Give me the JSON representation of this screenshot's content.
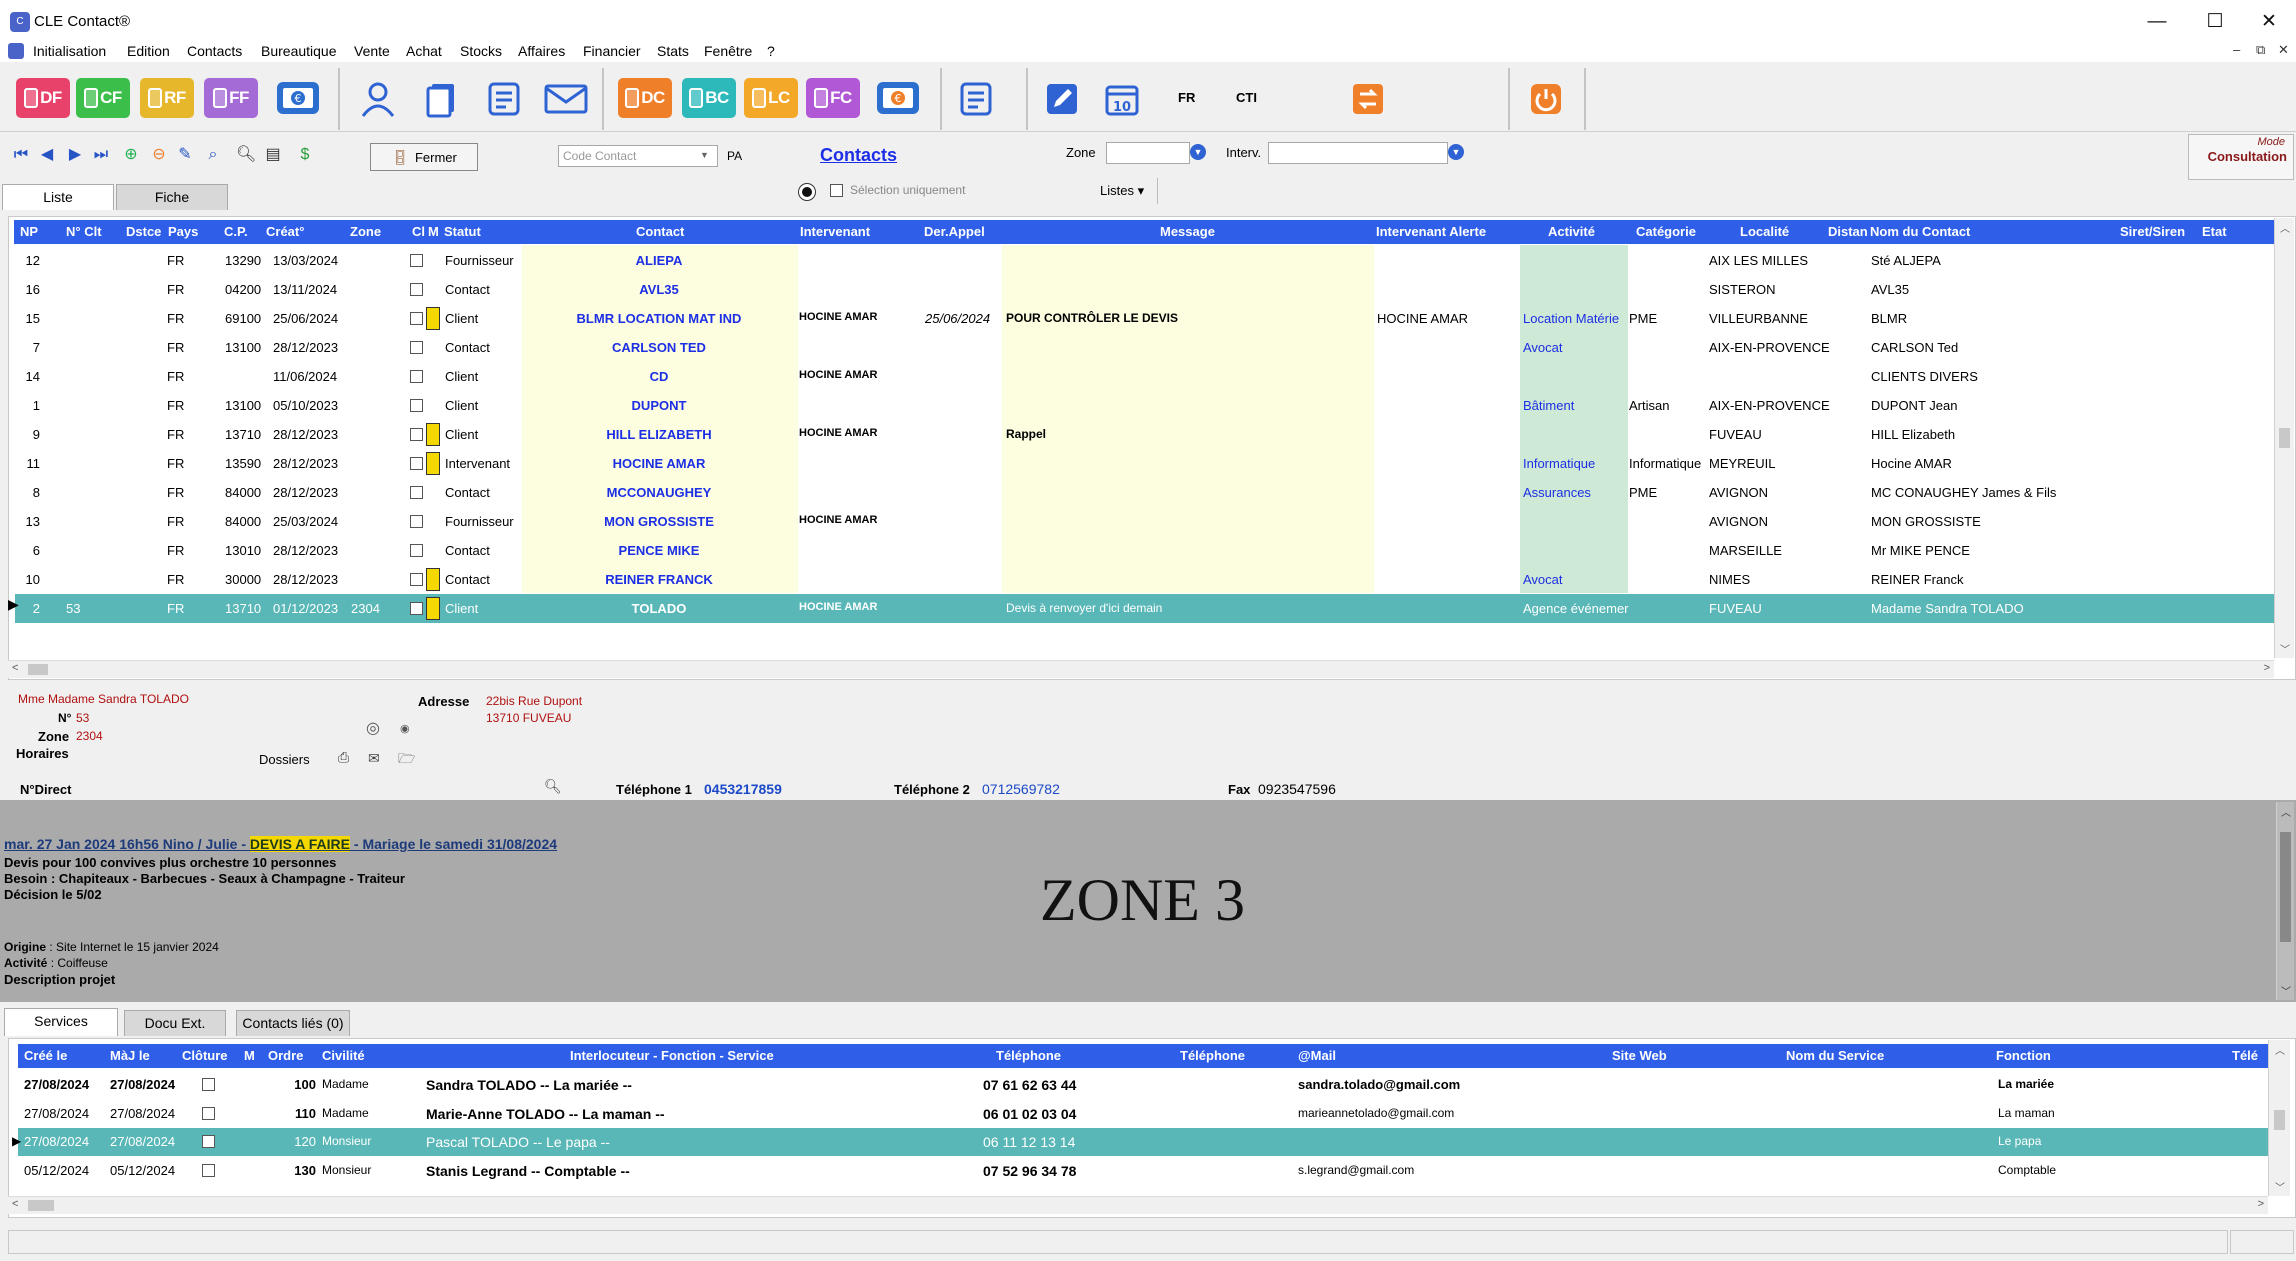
{
  "window": {
    "title": "CLE Contact®",
    "minimize": "—",
    "maximize": "☐",
    "close": "✕"
  },
  "menu": [
    "Initialisation",
    "Edition",
    "Contacts",
    "Bureautique",
    "Vente",
    "Achat",
    "Stocks",
    "Affaires",
    "Financier",
    "Stats",
    "Fenêtre",
    "?"
  ],
  "mdi_controls": [
    "–",
    "⧉",
    "✕"
  ],
  "toolbar": {
    "doc_buttons_left": [
      {
        "label": "DF",
        "color": "#e8426a"
      },
      {
        "label": "CF",
        "color": "#3bbf4a"
      },
      {
        "label": "RF",
        "color": "#e6b62b"
      },
      {
        "label": "FF",
        "color": "#a46ad6"
      }
    ],
    "doc_buttons_right": [
      {
        "label": "DC",
        "color": "#f07f2a"
      },
      {
        "label": "BC",
        "color": "#2db9b9"
      },
      {
        "label": "LC",
        "color": "#f3a828"
      },
      {
        "label": "FC",
        "color": "#b158d6"
      }
    ],
    "lang": "FR",
    "cti": "CTI"
  },
  "nav": {
    "close_label": "Fermer",
    "code_contact_placeholder": "Code Contact",
    "pa_label": "PA",
    "module_title": "Contacts",
    "zone_label": "Zone",
    "interv_label": "Interv.",
    "selection_label": "Sélection uniquement",
    "listes_label": "Listes ▾",
    "mode_label": "Mode",
    "mode_value": "Consultation"
  },
  "tabs": [
    "Liste",
    "Fiche"
  ],
  "grid": {
    "headers": [
      "NP",
      "N° Clt",
      "Dstce",
      "Pays",
      "C.P.",
      "Créat°",
      "Zone",
      "Cl",
      "M",
      "Statut",
      "Contact",
      "Intervenant",
      "Der.Appel",
      "Message",
      "Intervenant Alerte",
      "Activité",
      "Catégorie",
      "Localité",
      "Distan",
      "Nom du Contact",
      "Siret/Siren",
      "Etat"
    ],
    "rows": [
      {
        "np": "12",
        "clt": "",
        "pays": "FR",
        "cp": "13290",
        "creat": "13/03/2024",
        "zone": "",
        "note": false,
        "statut": "Fournisseur",
        "contact": "ALIEPA",
        "interv": "",
        "appel": "",
        "msg": "",
        "alerte": "",
        "activite": "",
        "cat": "",
        "loc": "AIX LES MILLES",
        "nom": "Sté ALJEPA"
      },
      {
        "np": "16",
        "clt": "",
        "pays": "FR",
        "cp": "04200",
        "creat": "13/11/2024",
        "zone": "",
        "note": false,
        "statut": "Contact",
        "contact": "AVL35",
        "interv": "",
        "appel": "",
        "msg": "",
        "alerte": "",
        "activite": "",
        "cat": "",
        "loc": "SISTERON",
        "nom": "AVL35"
      },
      {
        "np": "15",
        "clt": "",
        "pays": "FR",
        "cp": "69100",
        "creat": "25/06/2024",
        "zone": "",
        "note": true,
        "statut": "Client",
        "contact": "BLMR LOCATION MAT IND",
        "interv": "HOCINE AMAR",
        "appel": "25/06/2024",
        "msg": "POUR CONTRÔLER LE DEVIS",
        "alerte": "HOCINE AMAR",
        "activite": "Location Matérie",
        "cat": "PME",
        "loc": "VILLEURBANNE",
        "nom": "BLMR"
      },
      {
        "np": "7",
        "clt": "",
        "pays": "FR",
        "cp": "13100",
        "creat": "28/12/2023",
        "zone": "",
        "note": false,
        "statut": "Contact",
        "contact": "CARLSON TED",
        "interv": "",
        "appel": "",
        "msg": "",
        "alerte": "",
        "activite": "Avocat",
        "cat": "",
        "loc": "AIX-EN-PROVENCE",
        "nom": "CARLSON Ted"
      },
      {
        "np": "14",
        "clt": "",
        "pays": "FR",
        "cp": "",
        "creat": "11/06/2024",
        "zone": "",
        "note": false,
        "statut": "Client",
        "contact": "CD",
        "interv": "HOCINE AMAR",
        "appel": "",
        "msg": "",
        "alerte": "",
        "activite": "",
        "cat": "",
        "loc": "",
        "nom": "CLIENTS DIVERS"
      },
      {
        "np": "1",
        "clt": "",
        "pays": "FR",
        "cp": "13100",
        "creat": "05/10/2023",
        "zone": "",
        "note": false,
        "statut": "Client",
        "contact": "DUPONT",
        "interv": "",
        "appel": "",
        "msg": "",
        "alerte": "",
        "activite": "Bâtiment",
        "cat": "Artisan",
        "loc": "AIX-EN-PROVENCE",
        "nom": "DUPONT Jean"
      },
      {
        "np": "9",
        "clt": "",
        "pays": "FR",
        "cp": "13710",
        "creat": "28/12/2023",
        "zone": "",
        "note": true,
        "statut": "Client",
        "contact": "HILL ELIZABETH",
        "interv": "HOCINE AMAR",
        "appel": "",
        "msg": "Rappel",
        "alerte": "",
        "activite": "",
        "cat": "",
        "loc": "FUVEAU",
        "nom": "HILL Elizabeth"
      },
      {
        "np": "11",
        "clt": "",
        "pays": "FR",
        "cp": "13590",
        "creat": "28/12/2023",
        "zone": "",
        "note": true,
        "statut": "Intervenant",
        "contact": "HOCINE AMAR",
        "interv": "",
        "appel": "",
        "msg": "",
        "alerte": "",
        "activite": "Informatique",
        "cat": "Informatique",
        "loc": "MEYREUIL",
        "nom": "Hocine AMAR"
      },
      {
        "np": "8",
        "clt": "",
        "pays": "FR",
        "cp": "84000",
        "creat": "28/12/2023",
        "zone": "",
        "note": false,
        "statut": "Contact",
        "contact": "MCCONAUGHEY",
        "interv": "",
        "appel": "",
        "msg": "",
        "alerte": "",
        "activite": "Assurances",
        "cat": "PME",
        "loc": "AVIGNON",
        "nom": "MC CONAUGHEY James & Fils"
      },
      {
        "np": "13",
        "clt": "",
        "pays": "FR",
        "cp": "84000",
        "creat": "25/03/2024",
        "zone": "",
        "note": false,
        "statut": "Fournisseur",
        "contact": "MON GROSSISTE",
        "interv": "HOCINE AMAR",
        "appel": "",
        "msg": "",
        "alerte": "",
        "activite": "",
        "cat": "",
        "loc": "AVIGNON",
        "nom": "MON GROSSISTE"
      },
      {
        "np": "6",
        "clt": "",
        "pays": "FR",
        "cp": "13010",
        "creat": "28/12/2023",
        "zone": "",
        "note": false,
        "statut": "Contact",
        "contact": "PENCE MIKE",
        "interv": "",
        "appel": "",
        "msg": "",
        "alerte": "",
        "activite": "",
        "cat": "",
        "loc": "MARSEILLE",
        "nom": "Mr MIKE PENCE"
      },
      {
        "np": "10",
        "clt": "",
        "pays": "FR",
        "cp": "30000",
        "creat": "28/12/2023",
        "zone": "",
        "note": true,
        "statut": "Contact",
        "contact": "REINER FRANCK",
        "interv": "",
        "appel": "",
        "msg": "",
        "alerte": "",
        "activite": "Avocat",
        "cat": "",
        "loc": "NIMES",
        "nom": "REINER Franck"
      },
      {
        "np": "2",
        "clt": "53",
        "pays": "FR",
        "cp": "13710",
        "creat": "01/12/2023",
        "zone": "2304",
        "note": true,
        "statut": "Client",
        "contact": "TOLADO",
        "interv": "HOCINE AMAR",
        "appel": "",
        "msg": "Devis à renvoyer d'ici demain",
        "alerte": "",
        "activite": "Agence événemer",
        "cat": "",
        "loc": "FUVEAU",
        "nom": "Madame Sandra TOLADO",
        "selected": true
      }
    ]
  },
  "detail": {
    "civilite": "Mme Madame Sandra TOLADO",
    "no_label": "N°",
    "no_value": "53",
    "zone_label": "Zone",
    "zone_value": "2304",
    "horaires_label": "Horaires",
    "dossiers_label": "Dossiers",
    "adresse_label": "Adresse",
    "adresse_line1": "22bis Rue Dupont",
    "adresse_line2": "13710 FUVEAU",
    "ndirect_label": "N°Direct",
    "tel1_label": "Téléphone 1",
    "tel1_value": "0453217859",
    "tel2_label": "Téléphone 2",
    "tel2_value": "0712569782",
    "fax_label": "Fax",
    "fax_value": "0923547596"
  },
  "zone3": {
    "link_prefix": "mar. 27 Jan 2024 16h56  Nino / Julie - ",
    "link_highlight": "DEVIS A FAIRE",
    "link_suffix": " - Mariage le samedi 31/08/2024",
    "line1": "Devis pour 100 convives plus orchestre 10 personnes",
    "line2": "Besoin : Chapiteaux - Barbecues - Seaux à Champagne - Traiteur",
    "line3": "Décision le 5/02",
    "origine_label": "Origine",
    "origine_value": " : Site Internet le 15 janvier 2024",
    "activite_label": "Activité",
    "activite_value": " : Coiffeuse",
    "desc_label": "Description projet",
    "watermark": "ZONE 3"
  },
  "bottom_tabs": [
    "Services",
    "Docu Ext.",
    "Contacts liés (0)"
  ],
  "services": {
    "headers": [
      "Créé le",
      "MàJ le",
      "Clôture",
      "M",
      "Ordre",
      "Civilité",
      "Interlocuteur - Fonction - Service",
      "Téléphone",
      "Téléphone",
      "@Mail",
      "Site Web",
      "Nom du Service",
      "Fonction",
      "Télé"
    ],
    "rows": [
      {
        "cree": "27/08/2024",
        "maj": "27/08/2024",
        "ordre": "100",
        "civ": "Madame",
        "interloc": "Sandra TOLADO -- La mariée --",
        "tel": "07 61 62 63 44",
        "mail": "sandra.tolado@gmail.com",
        "fonction": "La mariée",
        "bold": true
      },
      {
        "cree": "27/08/2024",
        "maj": "27/08/2024",
        "ordre": "110",
        "civ": "Madame",
        "interloc": "Marie-Anne TOLADO -- La maman --",
        "tel": "06 01 02 03 04",
        "mail": "marieannetolado@gmail.com",
        "fonction": "La maman",
        "bold": false
      },
      {
        "cree": "27/08/2024",
        "maj": "27/08/2024",
        "ordre": "120",
        "civ": "Monsieur",
        "interloc": "Pascal TOLADO -- Le papa --",
        "tel": "06 11 12 13 14",
        "mail": "",
        "fonction": "Le papa",
        "bold": false,
        "selected": true
      },
      {
        "cree": "05/12/2024",
        "maj": "05/12/2024",
        "ordre": "130",
        "civ": "Monsieur",
        "interloc": "Stanis Legrand -- Comptable --",
        "tel": "07 52 96 34 78",
        "mail": "s.legrand@gmail.com",
        "fonction": "Comptable",
        "bold": false
      }
    ]
  }
}
